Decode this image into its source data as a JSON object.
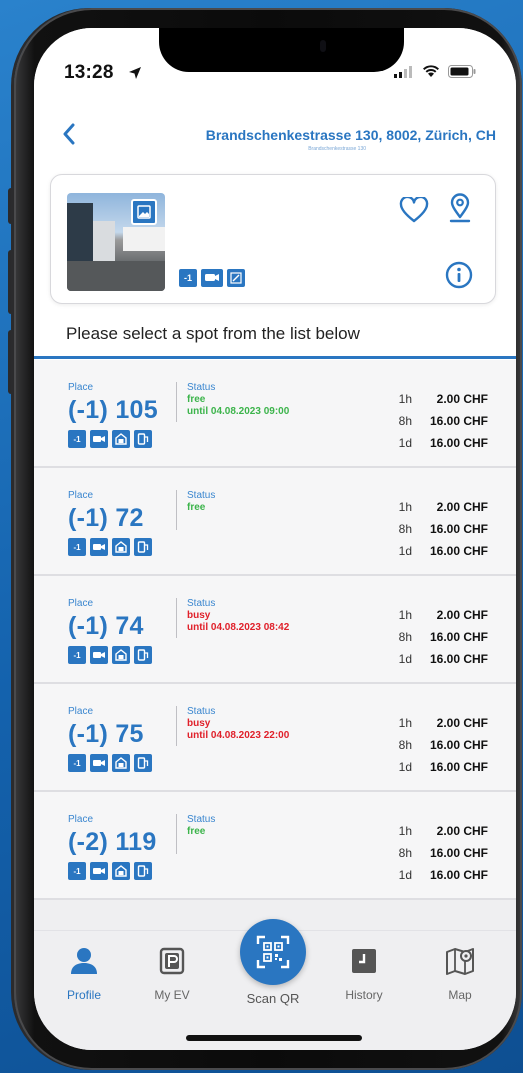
{
  "status_bar": {
    "time": "13:28"
  },
  "header": {
    "address": "Brandschenkestrasse 130, 8002, Zürich, CH",
    "address_sub": "Brandschenkestrasse 130"
  },
  "location_card": {
    "feature_icons": [
      "-1",
      "camera-icon",
      "parking-icon"
    ]
  },
  "prompt": "Please select a spot from the list below",
  "labels": {
    "place": "Place",
    "status": "Status"
  },
  "spots": [
    {
      "place": "(-1) 105",
      "status": "free",
      "until": "until 04.08.2023 09:00",
      "status_color": "#3cb44b",
      "prices": [
        {
          "d": "1h",
          "p": "2.00 CHF"
        },
        {
          "d": "8h",
          "p": "16.00 CHF"
        },
        {
          "d": "1d",
          "p": "16.00 CHF"
        }
      ]
    },
    {
      "place": "(-1) 72",
      "status": "free",
      "until": "",
      "status_color": "#3cb44b",
      "prices": [
        {
          "d": "1h",
          "p": "2.00 CHF"
        },
        {
          "d": "8h",
          "p": "16.00 CHF"
        },
        {
          "d": "1d",
          "p": "16.00 CHF"
        }
      ]
    },
    {
      "place": "(-1) 74",
      "status": "busy",
      "until": "until 04.08.2023 08:42",
      "status_color": "#e0202a",
      "prices": [
        {
          "d": "1h",
          "p": "2.00 CHF"
        },
        {
          "d": "8h",
          "p": "16.00 CHF"
        },
        {
          "d": "1d",
          "p": "16.00 CHF"
        }
      ]
    },
    {
      "place": "(-1) 75",
      "status": "busy",
      "until": "until 04.08.2023 22:00",
      "status_color": "#e0202a",
      "prices": [
        {
          "d": "1h",
          "p": "2.00 CHF"
        },
        {
          "d": "8h",
          "p": "16.00 CHF"
        },
        {
          "d": "1d",
          "p": "16.00 CHF"
        }
      ]
    },
    {
      "place": "(-2) 119",
      "status": "free",
      "until": "",
      "status_color": "#3cb44b",
      "prices": [
        {
          "d": "1h",
          "p": "2.00 CHF"
        },
        {
          "d": "8h",
          "p": "16.00 CHF"
        },
        {
          "d": "1d",
          "p": "16.00 CHF"
        }
      ]
    }
  ],
  "tabbar": {
    "profile": "Profile",
    "my_ev": "My EV",
    "scan_qr": "Scan QR",
    "history": "History",
    "map": "Map"
  },
  "colors": {
    "accent": "#2a76c1",
    "free": "#3cb44b",
    "busy": "#e0202a"
  }
}
